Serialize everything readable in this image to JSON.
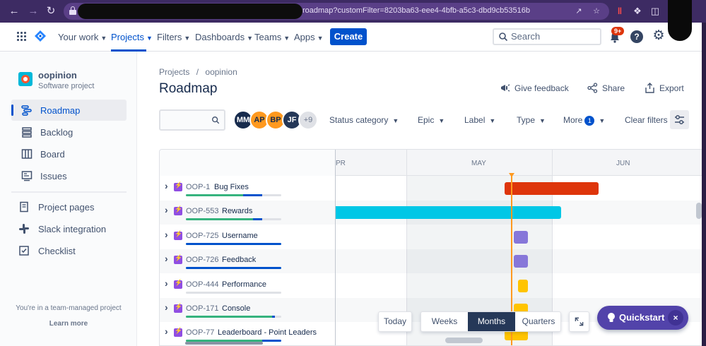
{
  "browser": {
    "url_suffix": "roadmap?customFilter=8203ba63-eee4-4bfb-a5c3-dbd9cb53516b"
  },
  "topnav": {
    "items": [
      "Your work",
      "Projects",
      "Filters",
      "Dashboards",
      "Teams",
      "Apps"
    ],
    "active": "Projects",
    "create_label": "Create",
    "search_placeholder": "Search",
    "notification_badge": "9+",
    "help_label": "?"
  },
  "sidebar": {
    "project_name": "oopinion",
    "project_type": "Software project",
    "items": [
      {
        "label": "Roadmap",
        "icon": "roadmap-icon",
        "active": true
      },
      {
        "label": "Backlog",
        "icon": "backlog-icon",
        "active": false
      },
      {
        "label": "Board",
        "icon": "board-icon",
        "active": false
      },
      {
        "label": "Issues",
        "icon": "issues-icon",
        "active": false
      }
    ],
    "links": [
      {
        "label": "Project pages",
        "icon": "project-pages-icon"
      },
      {
        "label": "Slack integration",
        "icon": "slack-icon"
      },
      {
        "label": "Checklist",
        "icon": "checklist-icon"
      }
    ],
    "footer_text": "You're in a team-managed project",
    "footer_link": "Learn more"
  },
  "main": {
    "breadcrumb_root": "Projects",
    "breadcrumb_sep": "/",
    "breadcrumb_project": "oopinion",
    "title": "Roadmap",
    "actions": [
      "Give feedback",
      "Share",
      "Export"
    ],
    "avatars": [
      {
        "initials": "MM",
        "color": "#172b4d"
      },
      {
        "initials": "AP",
        "color": "#ff991f"
      },
      {
        "initials": "BP",
        "color": "#ff991f"
      },
      {
        "initials": "JF",
        "color": "#253858"
      },
      {
        "initials": "+9",
        "color": "#dfe1e6"
      }
    ],
    "filters": [
      "Status category",
      "Epic",
      "Label",
      "Type",
      "More"
    ],
    "more_count": "1",
    "clear_filters": "Clear filters"
  },
  "roadmap": {
    "months": [
      "PR",
      "MAY",
      "JUN"
    ],
    "rows": [
      {
        "key": "OOP-1",
        "summary": "Bug Fixes",
        "done": 0.6,
        "inprogress": 0.2,
        "bar_color": "#de350b"
      },
      {
        "key": "OOP-553",
        "summary": "Rewards",
        "done": 0.7,
        "inprogress": 0.1,
        "bar_color": "#00c7e6"
      },
      {
        "key": "OOP-725",
        "summary": "Username",
        "done": 0.0,
        "inprogress": 1.0,
        "bar_color": "#8777d9"
      },
      {
        "key": "OOP-726",
        "summary": "Feedback",
        "done": 0.0,
        "inprogress": 1.0,
        "bar_color": "#8777d9"
      },
      {
        "key": "OOP-444",
        "summary": "Performance",
        "done": 0.0,
        "inprogress": 0.0,
        "bar_color": "#ffc400"
      },
      {
        "key": "OOP-171",
        "summary": "Console",
        "done": 0.9,
        "inprogress": 0.03,
        "bar_color": "#ffc400"
      },
      {
        "key": "OOP-77",
        "summary": "Leaderboard - Point Leaders",
        "done": 0.8,
        "inprogress": 0.2,
        "bar_color": "#ffc400"
      }
    ]
  },
  "zoom": {
    "today_label": "Today",
    "options": [
      "Weeks",
      "Months",
      "Quarters"
    ],
    "active": "Months"
  },
  "quickstart": {
    "label": "Quickstart",
    "close": "×"
  }
}
